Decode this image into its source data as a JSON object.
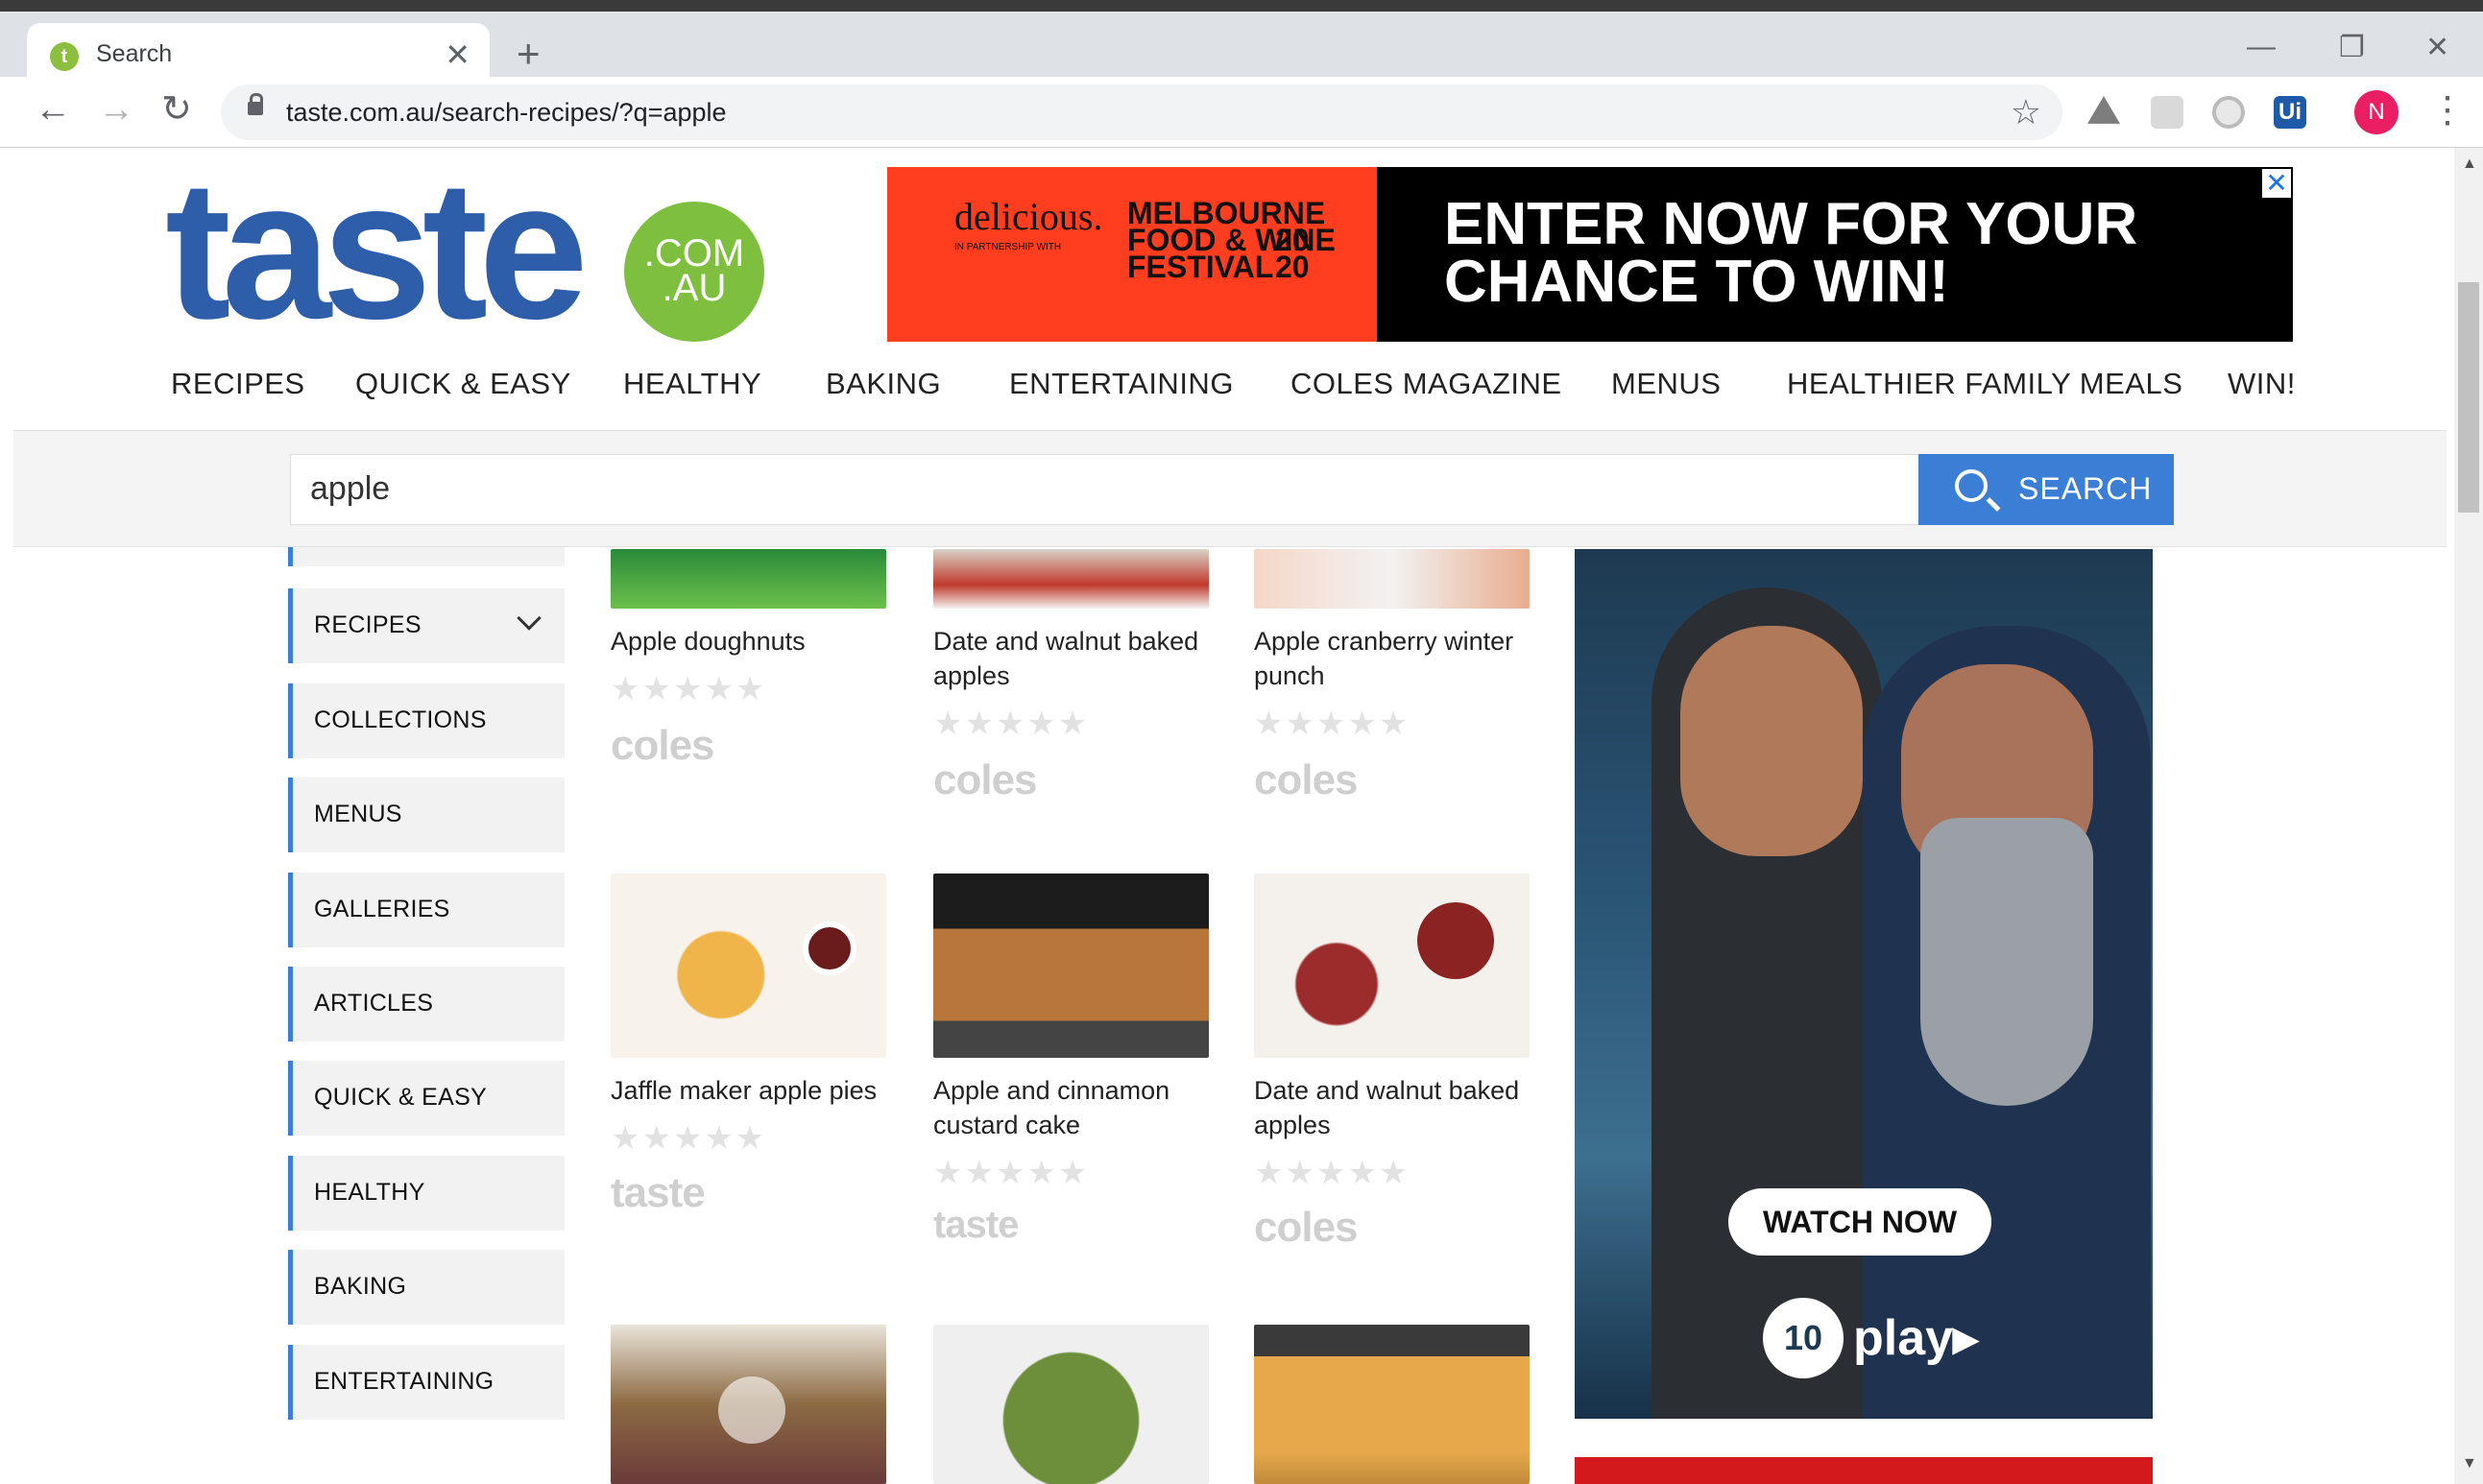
{
  "browser": {
    "tab_title": "Search",
    "tab_favicon_letter": "t",
    "url": "taste.com.au/search-recipes/?q=apple",
    "profile_initial": "N",
    "new_tab_glyph": "+",
    "close_tab_glyph": "✕"
  },
  "site": {
    "logo_word": "taste",
    "logo_badge_top": ".COM",
    "logo_badge_bottom": ".AU"
  },
  "top_ad": {
    "brand": "delicious.",
    "brand_sub": "IN PARTNERSHIP WITH",
    "event": "MELBOURNE FOOD & WINE FESTIVAL",
    "year_top": "20",
    "year_bottom": "20",
    "headline_1": "ENTER NOW FOR YOUR",
    "headline_2": "CHANCE TO WIN!",
    "close_glyph": "✕"
  },
  "main_nav": [
    "RECIPES",
    "QUICK & EASY",
    "HEALTHY",
    "BAKING",
    "ENTERTAINING",
    "COLES MAGAZINE",
    "MENUS",
    "HEALTHIER FAMILY MEALS",
    "WIN!"
  ],
  "search": {
    "value": "apple",
    "button_label": "SEARCH"
  },
  "sidebar": [
    "RECIPES",
    "COLLECTIONS",
    "MENUS",
    "GALLERIES",
    "ARTICLES",
    "QUICK & EASY",
    "HEALTHY",
    "BAKING",
    "ENTERTAINING"
  ],
  "cards": [
    {
      "title": "Apple doughnuts",
      "brand": "coles",
      "rating": 0
    },
    {
      "title": "Date and walnut baked apples",
      "brand": "coles",
      "rating": 0
    },
    {
      "title": "Apple cranberry winter punch",
      "brand": "coles",
      "rating": 0
    },
    {
      "title": "Jaffle maker apple pies",
      "brand": "taste",
      "rating": 0
    },
    {
      "title": "Apple and cinnamon custard cake",
      "brand": "taste",
      "rating": 0
    },
    {
      "title": "Date and walnut baked apples",
      "brand": "coles",
      "rating": 0
    }
  ],
  "stars_glyph": "★★★★★",
  "right_ad": {
    "cta": "WATCH NOW",
    "logo_number": "10",
    "logo_word": "play▸"
  },
  "colors": {
    "brand_blue": "#2e5ea9",
    "brand_green": "#7fbf3f",
    "accent_blue": "#3a7fd5",
    "ad_red": "#ff3d1f"
  }
}
